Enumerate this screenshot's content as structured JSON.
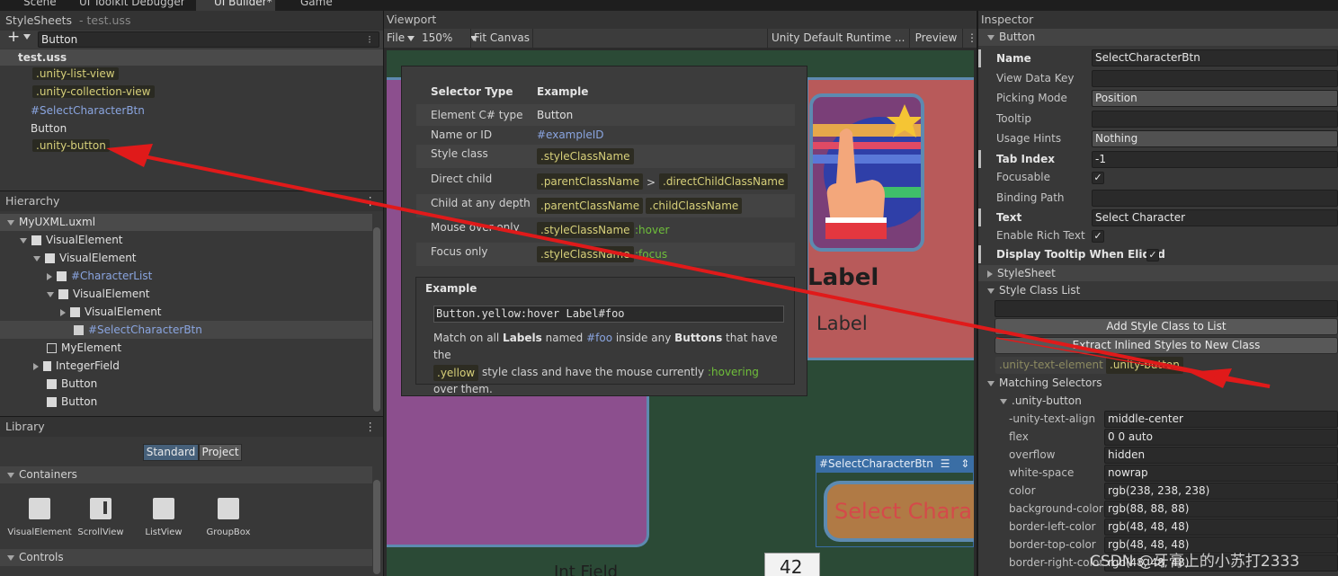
{
  "tabs": [
    "Scene",
    "UI Toolkit Debugger",
    "UI Builder*",
    "Game"
  ],
  "stylesheets": {
    "title": "StyleSheets",
    "subtitle": "- test.uss",
    "add": "+",
    "search_value": "Button",
    "file": "test.uss",
    "items": [
      ".unity-list-view",
      ".unity-collection-view",
      "#SelectCharacterBtn",
      "Button",
      ".unity-button"
    ]
  },
  "hierarchy": {
    "title": "Hierarchy",
    "root": "MyUXML.uxml",
    "items": [
      "VisualElement",
      "VisualElement",
      "#CharacterList",
      "VisualElement",
      "VisualElement",
      "#SelectCharacterBtn",
      "MyElement",
      "IntegerField",
      "Button",
      "Button"
    ]
  },
  "library": {
    "title": "Library",
    "tab_standard": "Standard",
    "tab_project": "Project",
    "containers": "Containers",
    "controls": "Controls",
    "items": [
      "VisualElement",
      "ScrollView",
      "ListView",
      "GroupBox"
    ]
  },
  "viewport": {
    "title": "Viewport",
    "file": "File",
    "zoom": "150%",
    "fit": "Fit Canvas",
    "theme": "Unity Default Runtime ...",
    "preview": "Preview",
    "label_big": "Label",
    "label_small": "Label",
    "select_badge": "#SelectCharacterBtn",
    "button_text": "Select Chara",
    "int_field": "Int Field",
    "num": "42"
  },
  "tooltip": {
    "col1": "Selector Type",
    "col2": "Example",
    "rows": {
      "r1_type": "Element C# type",
      "r1_ex": "Button",
      "r2_type": "Name or ID",
      "r2_ex": "#exampleID",
      "r3_type": "Style class",
      "r3_ex": ".styleClassName",
      "r4_type": "Direct child",
      "r4_ex1": ".parentClassName",
      "r4_gt": ">",
      "r4_ex2": ".directChildClassName",
      "r5_type": "Child at any depth",
      "r5_ex1": ".parentClassName",
      "r5_ex2": ".childClassName",
      "r6_type": "Mouse over only",
      "r6_ex": ".styleClassName",
      "r6_ps": ":hover",
      "r7_type": "Focus only",
      "r7_ex": ".styleClassName",
      "r7_ps": ":focus"
    },
    "example_title": "Example",
    "example_code": "Button.yellow:hover Label#foo",
    "desc_1": "Match on all",
    "desc_labels": "Labels",
    "desc_2": "named",
    "desc_foo": "#foo",
    "desc_3": "inside any",
    "desc_buttons": "Buttons",
    "desc_4": "that have the",
    "desc_yellow": ".yellow",
    "desc_5": "style class and have the mouse currently",
    "desc_hovering": ":hovering",
    "desc_6": "over them."
  },
  "inspector": {
    "title": "Inspector",
    "section": "Button",
    "fields": {
      "name_l": "Name",
      "name_v": "SelectCharacterBtn",
      "vdk_l": "View Data Key",
      "vdk_v": "",
      "pm_l": "Picking Mode",
      "pm_v": "Position",
      "tt_l": "Tooltip",
      "tt_v": "",
      "uh_l": "Usage Hints",
      "uh_v": "Nothing",
      "ti_l": "Tab Index",
      "ti_v": "-1",
      "fo_l": "Focusable",
      "bp_l": "Binding Path",
      "bp_v": "",
      "tx_l": "Text",
      "tx_v": "Select Character",
      "ert_l": "Enable Rich Text",
      "dte_l": "Display Tooltip When Elided"
    },
    "stylesheet": "StyleSheet",
    "scl": "Style Class List",
    "add_class": "Add Style Class to List",
    "extract": "Extract Inlined Styles to New Class",
    "class1": ".unity-text-element",
    "class2": ".unity-button",
    "matching": "Matching Selectors",
    "match_sel": ".unity-button",
    "props": {
      "p1": "-unity-text-align",
      "v1": "middle-center",
      "p2": "flex",
      "v2": "0 0 auto",
      "p3": "overflow",
      "v3": "hidden",
      "p4": "white-space",
      "v4": "nowrap",
      "p5": "color",
      "v5": "rgb(238, 238, 238)",
      "p6": "background-color",
      "v6": "rgb(88, 88, 88)",
      "p7": "border-left-color",
      "v7": "rgb(48, 48, 48)",
      "p8": "border-top-color",
      "v8": "rgb(48, 48, 48)",
      "p9": "border-right-color",
      "v9": "rgb(48, 48, 48)"
    }
  },
  "watermark": "CSDN @牙膏上的小苏打2333",
  "colors": {
    "canvas_bg": "#2b4a36",
    "purple_panel": "#8c4f8e",
    "red_panel": "#b85a5a",
    "arrow": "#e01a1a",
    "button_fill": "#b07a45"
  }
}
